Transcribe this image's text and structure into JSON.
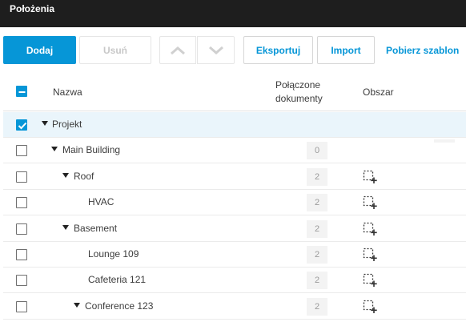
{
  "window": {
    "title": "Położenia"
  },
  "toolbar": {
    "add_label": "Dodaj",
    "delete_label": "Usuń",
    "export_label": "Eksportuj",
    "import_label": "Import",
    "download_template_label": "Pobierz szablon"
  },
  "table": {
    "headers": {
      "name": "Nazwa",
      "linked_docs_line1": "Połączone",
      "linked_docs_line2": "dokumenty",
      "area": "Obszar"
    },
    "rows": [
      {
        "name": "Projekt",
        "level": 0,
        "expanded": true,
        "checked": true,
        "count": "",
        "area_icon": false
      },
      {
        "name": "Main Building",
        "level": 1,
        "expanded": true,
        "checked": false,
        "count": "0",
        "area_icon": false
      },
      {
        "name": "Roof",
        "level": 2,
        "expanded": true,
        "checked": false,
        "count": "2",
        "area_icon": true
      },
      {
        "name": "HVAC",
        "level": 3,
        "expanded": false,
        "checked": false,
        "count": "2",
        "area_icon": true
      },
      {
        "name": "Basement",
        "level": 2,
        "expanded": true,
        "checked": false,
        "count": "2",
        "area_icon": true
      },
      {
        "name": "Lounge 109",
        "level": 3,
        "expanded": false,
        "checked": false,
        "count": "2",
        "area_icon": true
      },
      {
        "name": "Cafeteria 121",
        "level": 3,
        "expanded": false,
        "checked": false,
        "count": "2",
        "area_icon": true
      },
      {
        "name": "Conference 123",
        "level": 3,
        "expanded": true,
        "checked": false,
        "count": "2",
        "area_icon": true
      }
    ]
  },
  "colors": {
    "accent": "#0696d7",
    "titlebar": "#1e1e1e",
    "selected_row": "#eaf5fb"
  }
}
